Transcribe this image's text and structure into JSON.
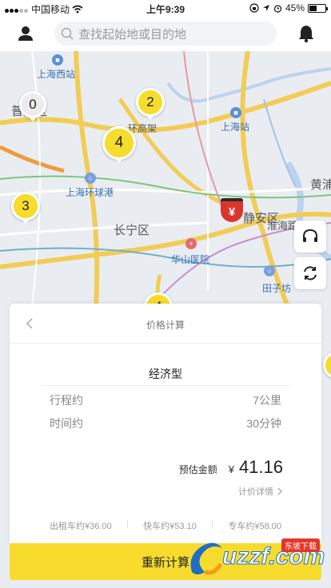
{
  "status_bar": {
    "carrier": "中国移动",
    "time": "上午9:39",
    "battery_percent": "45%",
    "battery_level": 0.45
  },
  "top_bar": {
    "search_placeholder": "查找起始地或目的地",
    "left_icon": "user-icon",
    "right_icon": "bell-icon"
  },
  "map": {
    "labels": {
      "shanghai_west_station": "上海西站",
      "shanghai_station": "上海站",
      "putuo": "普陀区",
      "huangpu": "黄浦",
      "harbour": "上海环球港",
      "changning": "长宁区",
      "jingan": "静安区",
      "huaihai": "淮海路",
      "huashan": "华山医院",
      "tianzifang": "田子坊",
      "ring": "环高架"
    },
    "clusters": {
      "c0": "0",
      "c2": "2",
      "c4": "4",
      "c3": "3",
      "c4b": "4"
    },
    "marker_symbol": "¥",
    "side_icons": [
      "headset-icon",
      "refresh-icon"
    ]
  },
  "card": {
    "title": "价格计算",
    "car_type": "经济型",
    "distance_label": "行程约",
    "distance_value": "7公里",
    "time_label": "时间约",
    "time_value": "30分钟",
    "estimate_label": "预估金额",
    "currency": "¥",
    "estimate_amount": "41.16",
    "detail_link": "计价详情",
    "others": [
      "出租车约¥36.00",
      "快车约¥53.10",
      "专车约¥58.00"
    ]
  },
  "action": {
    "recalc_label": "重新计算"
  },
  "watermark": {
    "text": "uzzf.com",
    "sub": "东坡下载"
  },
  "colors": {
    "accent_yellow": "#f7dc2e",
    "marker_red": "#d9362b"
  }
}
